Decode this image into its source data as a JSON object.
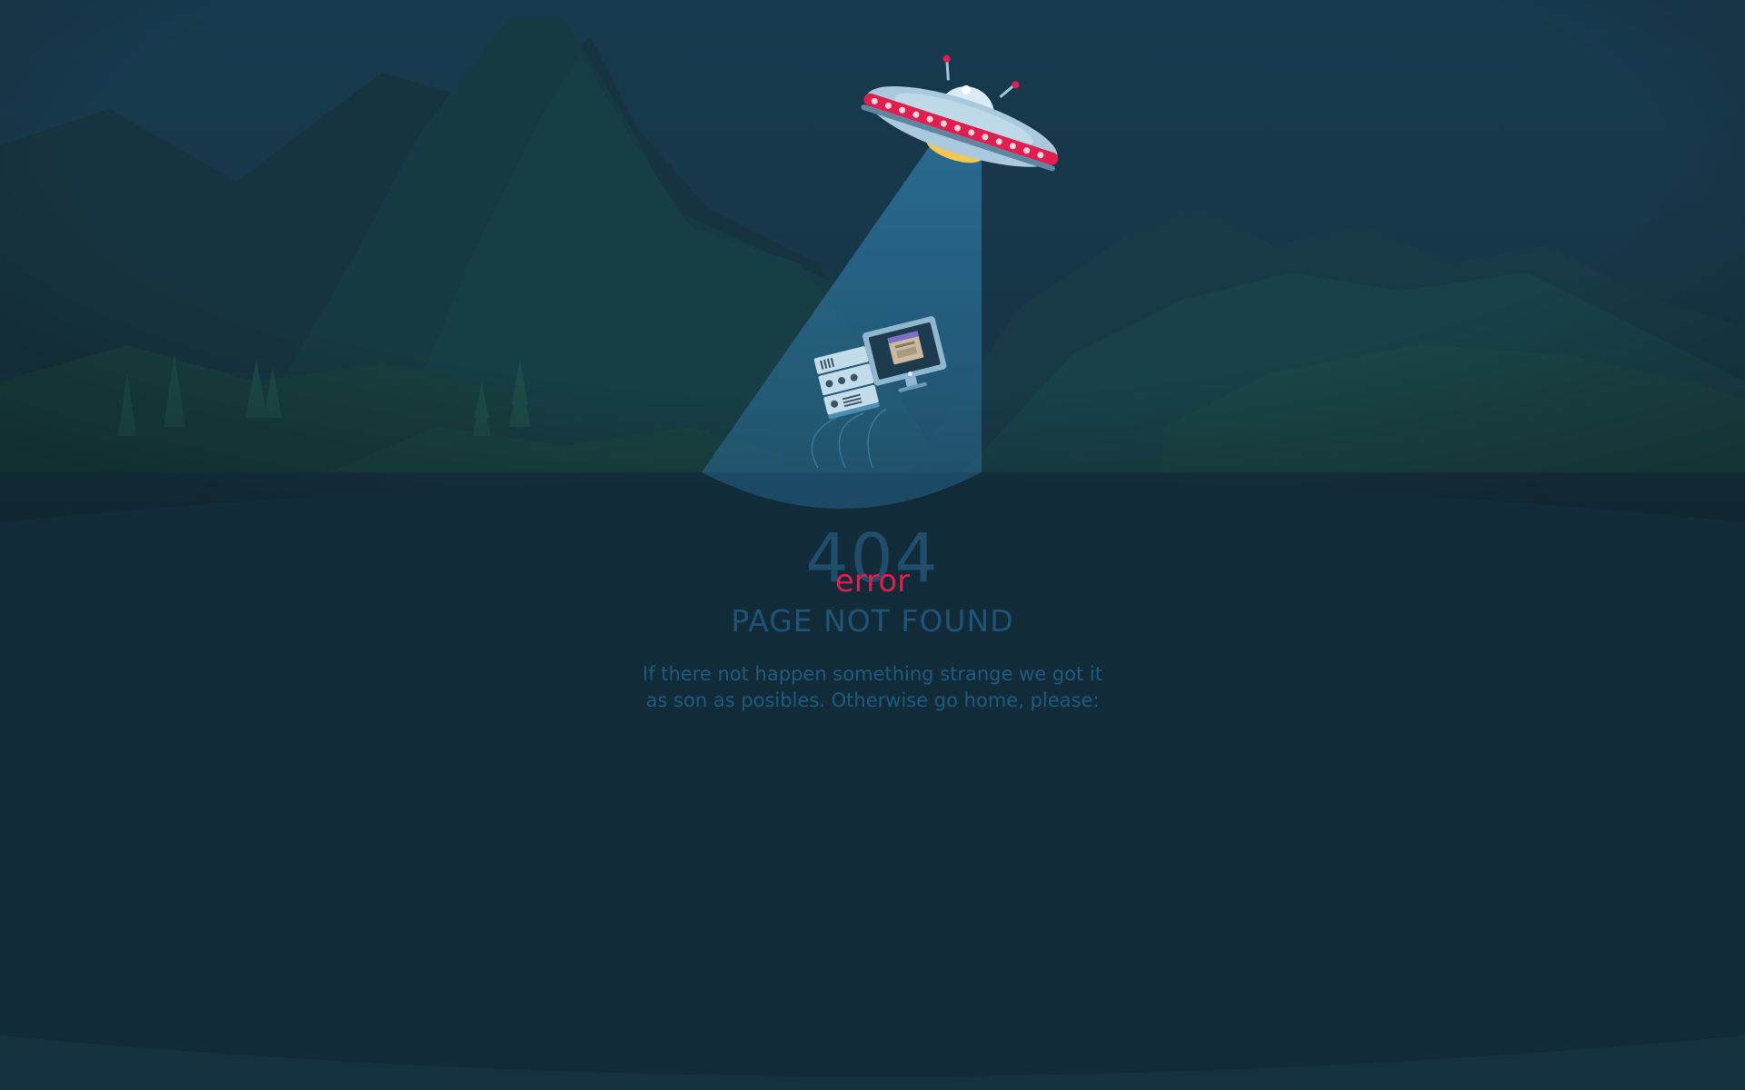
{
  "error_page": {
    "code": "404",
    "label": "error",
    "headline": "PAGE NOT FOUND",
    "message_line_1": "If there not happen something strange we got it",
    "message_line_2": "as son as posibles. Otherwise go home, please:"
  },
  "illustration": {
    "subject": "ufo-abducting-computer",
    "icons": [
      "ufo-icon",
      "computer-icon",
      "mountains",
      "pine-trees"
    ]
  },
  "colors": {
    "background": "#122b38",
    "sky": "#17394b",
    "accent": "#e21e4f",
    "code": "#1f4d6b",
    "text": "#1f5b80",
    "beam": "#2b6d95"
  }
}
